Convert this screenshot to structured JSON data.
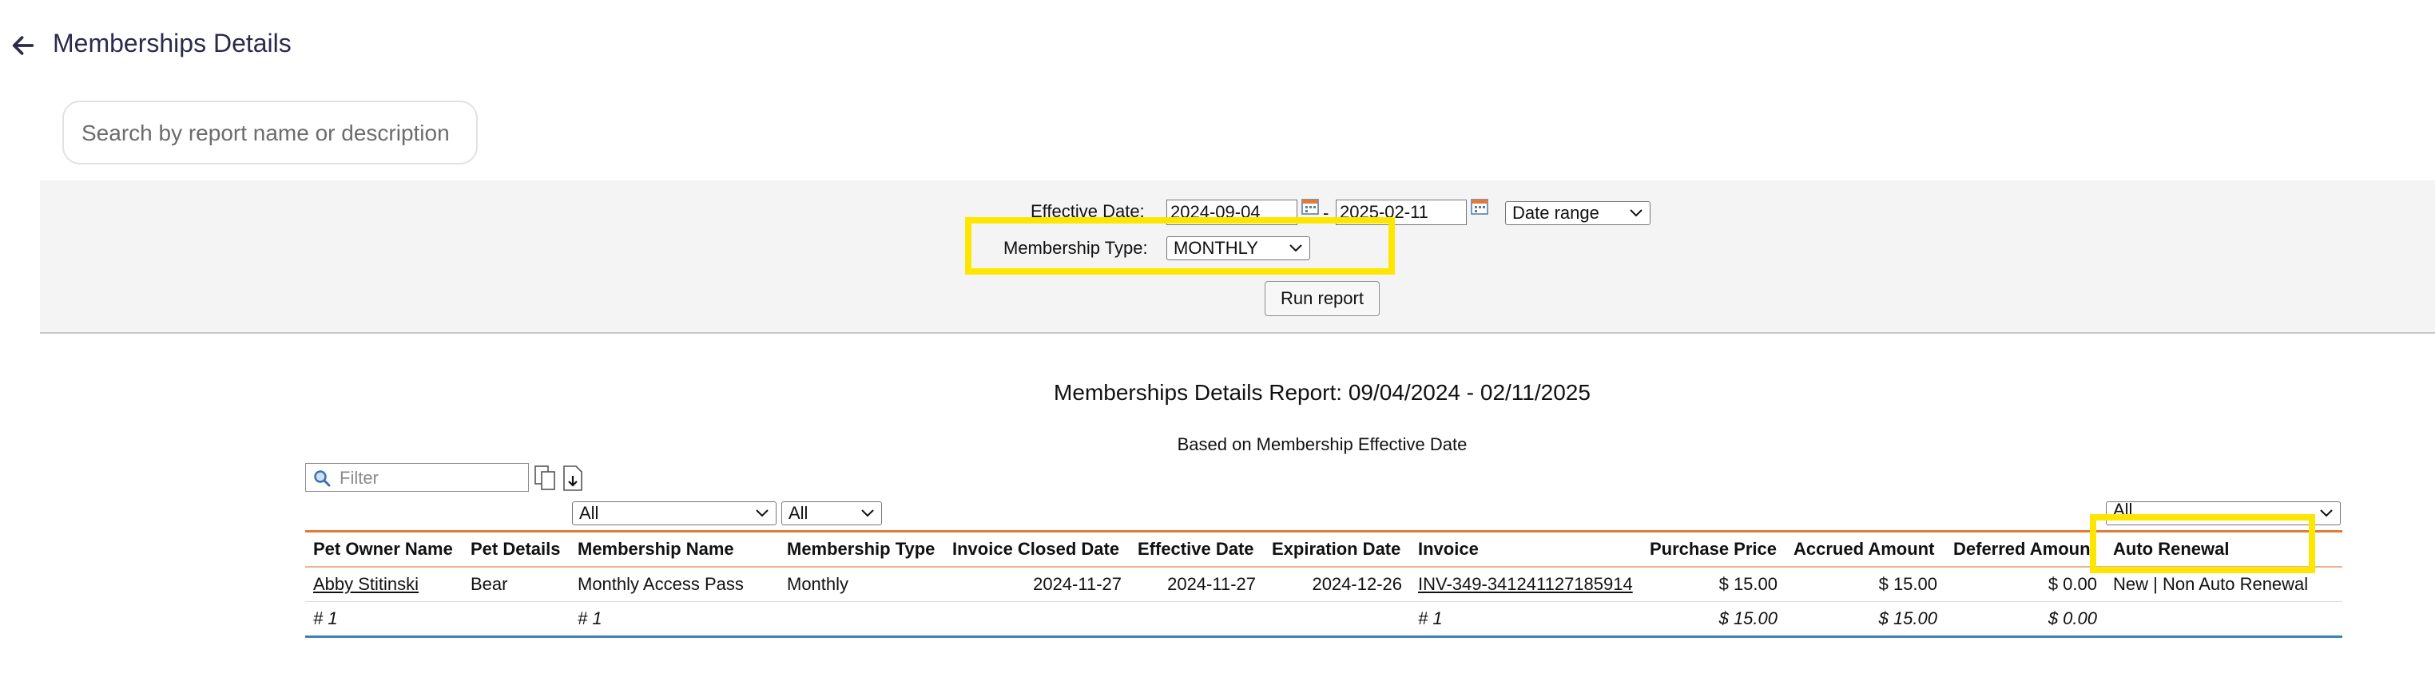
{
  "header": {
    "title": "Memberships Details"
  },
  "search": {
    "placeholder": "Search by report name or description"
  },
  "filters": {
    "effective_date_label": "Effective Date:",
    "start_date": "2024-09-04",
    "separator": "-",
    "end_date": "2025-02-11",
    "date_range_option": "Date range",
    "membership_type_label": "Membership Type:",
    "membership_type_value": "MONTHLY",
    "run_label": "Run report"
  },
  "report": {
    "title": "Memberships Details Report: 09/04/2024 - 02/11/2025",
    "subtitle": "Based on Membership Effective Date",
    "filter_placeholder": "Filter",
    "column_filters": {
      "membership_name": "All",
      "membership_type": "All",
      "auto_renewal": "All"
    },
    "columns": [
      "Pet Owner Name",
      "Pet Details",
      "Membership Name",
      "Membership Type",
      "Invoice Closed Date",
      "Effective Date",
      "Expiration Date",
      "Invoice",
      "Purchase Price",
      "Accrued Amount",
      "Deferred Amoun",
      "Auto Renewal"
    ],
    "rows": [
      {
        "pet_owner_name": "Abby Stitinski",
        "pet_details": "Bear",
        "membership_name": "Monthly Access Pass",
        "membership_type": "Monthly",
        "invoice_closed_date": "2024-11-27",
        "effective_date": "2024-11-27",
        "expiration_date": "2024-12-26",
        "invoice": "INV-349-341241127185914",
        "purchase_price": "$ 15.00",
        "accrued_amount": "$ 15.00",
        "deferred_amount": "$ 0.00",
        "auto_renewal": "New | Non Auto Renewal"
      }
    ],
    "totals": {
      "pet_owner_name": "# 1",
      "membership_name": "# 1",
      "invoice": "# 1",
      "purchase_price": "$ 15.00",
      "accrued_amount": "$ 15.00",
      "deferred_amount": "$ 0.00"
    }
  },
  "colors": {
    "highlight": "#ffe600",
    "header_rule": "#e07b3c",
    "total_rule": "#3b82b5",
    "panel_bg": "#f4f4f4"
  }
}
